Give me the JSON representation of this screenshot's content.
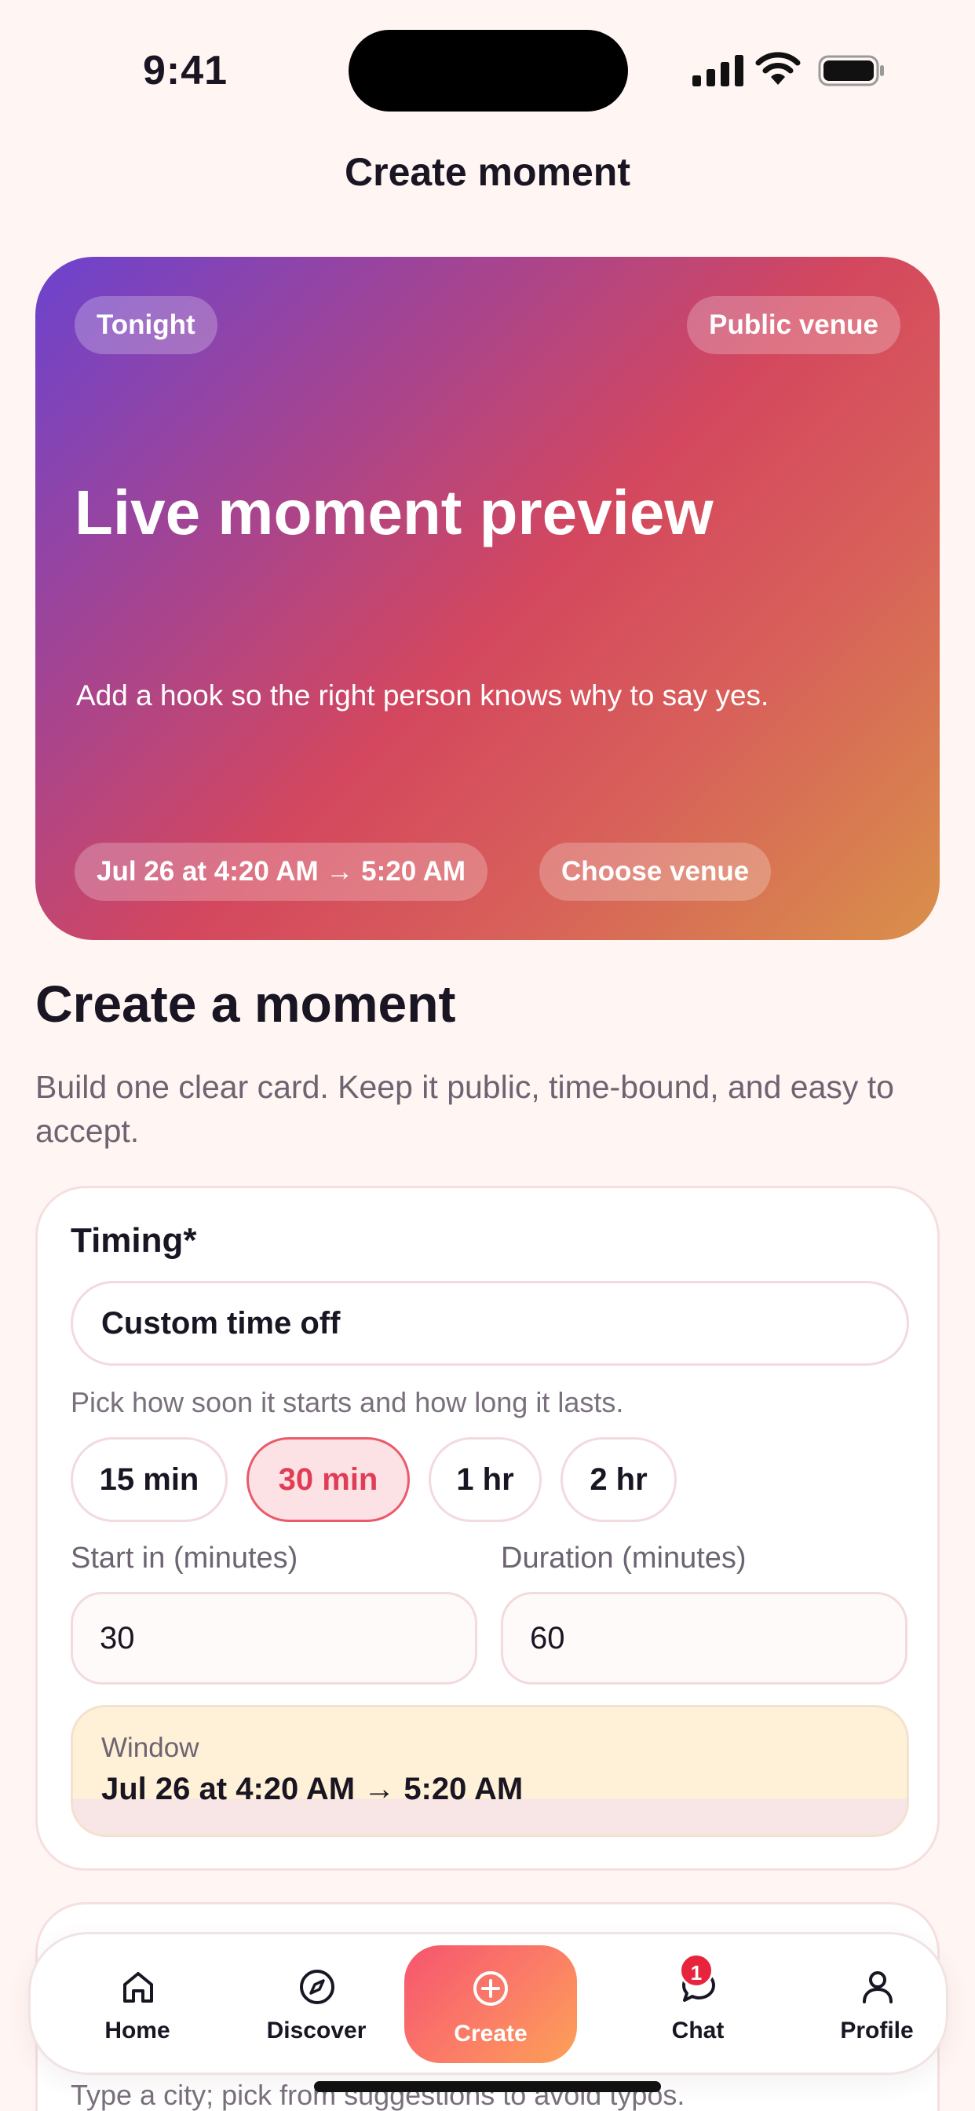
{
  "status_bar": {
    "time": "9:41"
  },
  "header": {
    "title": "Create moment"
  },
  "preview": {
    "chip_time": "Tonight",
    "chip_venue_type": "Public venue",
    "title": "Live moment preview",
    "subtitle": "Add a hook so the right person knows why to say yes.",
    "chip_window": "Jul 26 at 4:20 AM → 5:20 AM",
    "chip_venue": "Choose venue"
  },
  "intro": {
    "title": "Create a moment",
    "description": "Build one clear card. Keep it public, time-bound, and easy to accept."
  },
  "timing": {
    "label": "Timing*",
    "custom_toggle": "Custom time off",
    "hint": "Pick how soon it starts and how long it lasts.",
    "presets": [
      {
        "label": "15 min",
        "selected": false
      },
      {
        "label": "30 min",
        "selected": true
      },
      {
        "label": "1 hr",
        "selected": false
      },
      {
        "label": "2 hr",
        "selected": false
      }
    ],
    "start_label": "Start in (minutes)",
    "start_value": "30",
    "duration_label": "Duration (minutes)",
    "duration_value": "60",
    "window_label": "Window",
    "window_value": "Jul 26 at 4:20 AM → 5:20 AM"
  },
  "location": {
    "hint": "Type a city; pick from suggestions to avoid typos."
  },
  "tabbar": {
    "items": [
      {
        "label": "Home",
        "icon": "home-icon"
      },
      {
        "label": "Discover",
        "icon": "compass-icon"
      },
      {
        "label": "Create",
        "icon": "plus-circle-icon"
      },
      {
        "label": "Chat",
        "icon": "chat-bubble-icon"
      },
      {
        "label": "Profile",
        "icon": "person-icon"
      }
    ],
    "chat_badge": "1",
    "active": "Create"
  },
  "colors": {
    "background": "#fff5f3",
    "accent": "#e03e57",
    "badge": "#e7243c",
    "window_bg": "#fff1d8"
  }
}
